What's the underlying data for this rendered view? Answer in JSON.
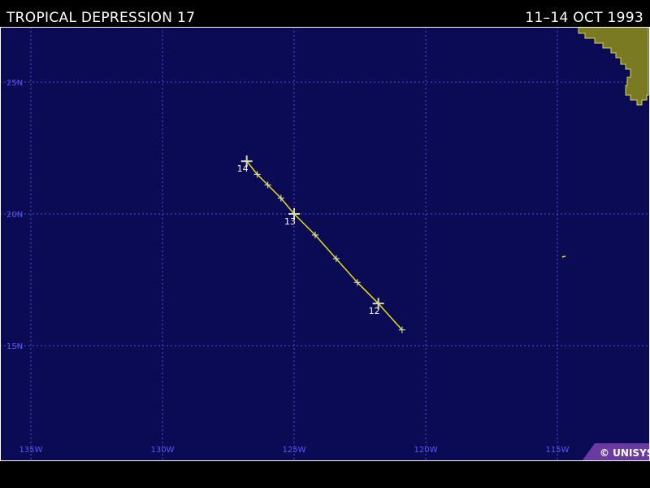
{
  "header": {
    "title": "TROPICAL DEPRESSION 17",
    "dates": "11–14 OCT 1993"
  },
  "colors": {
    "ocean": "#0a0a55",
    "grid": "#4f4fe0",
    "grid_labels": "#5a5af0",
    "track": "#e6e000",
    "markers": "#d8d8b0",
    "land": "#7a7a22",
    "land_edge": "#d8d860",
    "frame": "#ffffff"
  },
  "map": {
    "longitude_labels": [
      "135W",
      "130W",
      "125W",
      "120W",
      "115W"
    ],
    "latitude_labels": [
      "25N",
      "20N",
      "15N"
    ]
  },
  "track": {
    "points": [
      {
        "lon": -126.8,
        "lat": 22.0,
        "label": "14",
        "major": true
      },
      {
        "lon": -126.4,
        "lat": 21.5,
        "label": "",
        "major": false
      },
      {
        "lon": -126.0,
        "lat": 21.1,
        "label": "",
        "major": false
      },
      {
        "lon": -125.5,
        "lat": 20.6,
        "label": "",
        "major": false
      },
      {
        "lon": -125.0,
        "lat": 20.0,
        "label": "13",
        "major": true
      },
      {
        "lon": -124.2,
        "lat": 19.2,
        "label": "",
        "major": false
      },
      {
        "lon": -123.4,
        "lat": 18.3,
        "label": "",
        "major": false
      },
      {
        "lon": -122.6,
        "lat": 17.4,
        "label": "",
        "major": false
      },
      {
        "lon": -121.8,
        "lat": 16.6,
        "label": "12",
        "major": true
      },
      {
        "lon": -120.9,
        "lat": 15.6,
        "label": "",
        "major": false
      }
    ]
  },
  "credit": {
    "text": "© UNISYS"
  }
}
